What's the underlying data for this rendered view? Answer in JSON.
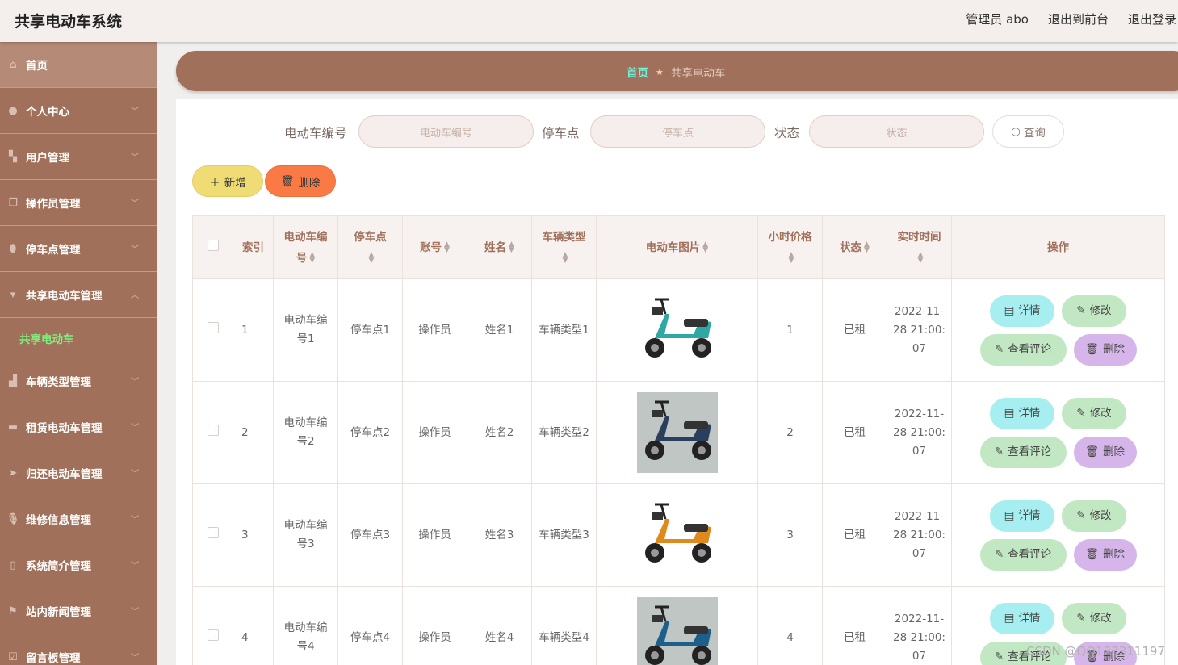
{
  "app_title": "共享电动车系统",
  "topbar": {
    "admin": "管理员 abo",
    "to_front": "退出到前台",
    "logout": "退出登录"
  },
  "sidebar": {
    "items": [
      {
        "label": "首页",
        "icon": "home-icon",
        "active": true
      },
      {
        "label": "个人中心",
        "icon": "user-icon"
      },
      {
        "label": "用户管理",
        "icon": "users-icon"
      },
      {
        "label": "操作员管理",
        "icon": "copy-icon"
      },
      {
        "label": "停车点管理",
        "icon": "location-icon"
      },
      {
        "label": "共享电动车管理",
        "icon": "scooter-icon",
        "expanded": true
      },
      {
        "label": "车辆类型管理",
        "icon": "truck-icon"
      },
      {
        "label": "租赁电动车管理",
        "icon": "briefcase-icon"
      },
      {
        "label": "归还电动车管理",
        "icon": "send-icon"
      },
      {
        "label": "维修信息管理",
        "icon": "mic-icon"
      },
      {
        "label": "系统简介管理",
        "icon": "phone-icon"
      },
      {
        "label": "站内新闻管理",
        "icon": "flag-icon"
      },
      {
        "label": "留言板管理",
        "icon": "check-icon"
      }
    ],
    "submenu_active": "共享电动车"
  },
  "breadcrumb": {
    "home": "首页",
    "separator": "★",
    "current": "共享电动车"
  },
  "search": {
    "field1_label": "电动车编号",
    "field1_placeholder": "电动车编号",
    "field2_label": "停车点",
    "field2_placeholder": "停车点",
    "field3_label": "状态",
    "field3_placeholder": "状态",
    "button": "查询"
  },
  "actions": {
    "add": "新增",
    "delete": "删除"
  },
  "table": {
    "headers": {
      "index": "索引",
      "bike_no": "电动车编号",
      "parking": "停车点",
      "account": "账号",
      "name": "姓名",
      "type": "车辆类型",
      "image": "电动车图片",
      "price": "小时价格",
      "status": "状态",
      "time": "实时时间",
      "ops": "操作"
    },
    "rows": [
      {
        "index": "1",
        "bike_no": "电动车编号1",
        "parking": "停车点1",
        "account": "操作员",
        "name": "姓名1",
        "type": "车辆类型1",
        "price": "1",
        "status": "已租",
        "time": "2022-11-28 21:00:07",
        "image_color": "#2fa7a2"
      },
      {
        "index": "2",
        "bike_no": "电动车编号2",
        "parking": "停车点2",
        "account": "操作员",
        "name": "姓名2",
        "type": "车辆类型2",
        "price": "2",
        "status": "已租",
        "time": "2022-11-28 21:00:07",
        "image_color": "#2a3f5c"
      },
      {
        "index": "3",
        "bike_no": "电动车编号3",
        "parking": "停车点3",
        "account": "操作员",
        "name": "姓名3",
        "type": "车辆类型3",
        "price": "3",
        "status": "已租",
        "time": "2022-11-28 21:00:07",
        "image_color": "#e08a1e"
      },
      {
        "index": "4",
        "bike_no": "电动车编号4",
        "parking": "停车点4",
        "account": "操作员",
        "name": "姓名4",
        "type": "车辆类型4",
        "price": "4",
        "status": "已租",
        "time": "2022-11-28 21:00:07",
        "image_color": "#1d5f8a"
      }
    ],
    "row_ops": {
      "detail": "详情",
      "edit": "修改",
      "review": "查看评论",
      "delete": "删除"
    }
  },
  "watermark": "CSDN @QQ123311197",
  "colors": {
    "sidebar_bg": "#a0705a",
    "submenu_active": "#7ef07e",
    "add_btn": "#f0dc74",
    "delete_btn": "#f97a45",
    "detail_btn": "#a6eef0",
    "edit_btn": "#c2e7c3",
    "row_delete_btn": "#d6b6ea"
  }
}
